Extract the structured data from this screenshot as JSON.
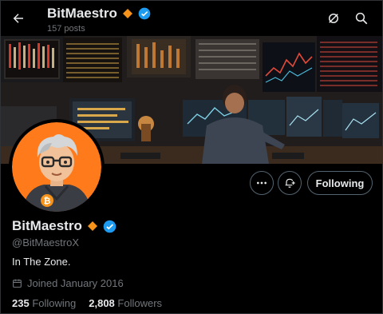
{
  "header": {
    "title": "BitMaestro",
    "posts_count": "157 posts"
  },
  "profile": {
    "display_name": "BitMaestro",
    "handle": "@BitMaestroX",
    "bio": "In The Zone.",
    "joined": "Joined January 2016",
    "following_count": "235",
    "following_label": "Following",
    "followers_count": "2,808",
    "followers_label": "Followers"
  },
  "actions": {
    "follow_state_label": "Following"
  },
  "icons": {
    "back": "arrow-left-icon",
    "grok": "grok-icon",
    "search": "search-icon",
    "more": "more-icon",
    "notify": "bell-plus-icon",
    "calendar": "calendar-icon",
    "verified": "verified-badge-icon",
    "diamond": "diamond-badge-icon"
  },
  "colors": {
    "background": "#000000",
    "text": "#e7e9ea",
    "muted": "#71767b",
    "verified": "#1d9bf0",
    "diamond": "#f7931a",
    "avatar_bg": "#ff7a1a"
  }
}
